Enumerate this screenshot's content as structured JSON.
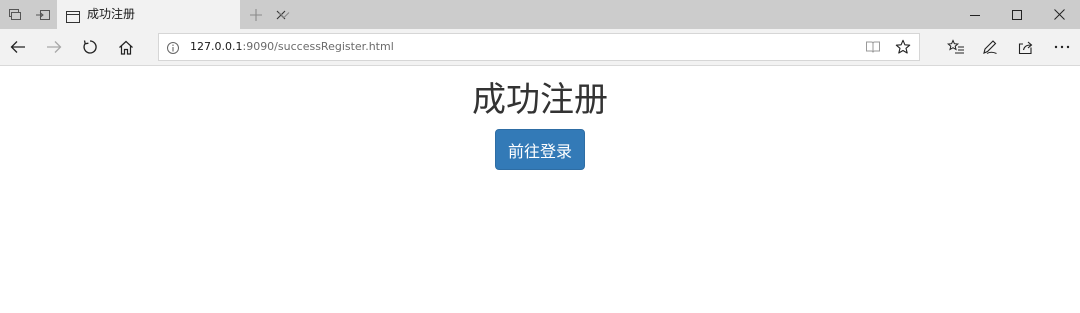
{
  "browser": {
    "tab": {
      "title": "成功注册"
    },
    "address_bar": {
      "url_host": "127.0.0.1",
      "url_rest": ":9090/successRegister.html"
    },
    "icons": {
      "tab_preview": "tab-preview-icon",
      "set_aside": "set-aside-tabs-icon",
      "page": "page-icon",
      "close_tab": "close-icon",
      "new_tab": "plus-icon",
      "tab_list": "chevron-down-icon",
      "minimize": "minimize-icon",
      "maximize": "maximize-icon",
      "close_window": "close-icon",
      "back": "back-arrow-icon",
      "forward": "forward-arrow-icon",
      "refresh": "refresh-icon",
      "home": "home-icon",
      "info": "info-icon",
      "reading_view": "reading-view-icon",
      "favorite": "star-icon",
      "favorites_hub": "favorites-list-icon",
      "web_note": "pen-icon",
      "share": "share-icon",
      "more": "more-icon"
    }
  },
  "page": {
    "heading": "成功注册",
    "login_button_label": "前往登录",
    "button_color": "#337ab7"
  }
}
